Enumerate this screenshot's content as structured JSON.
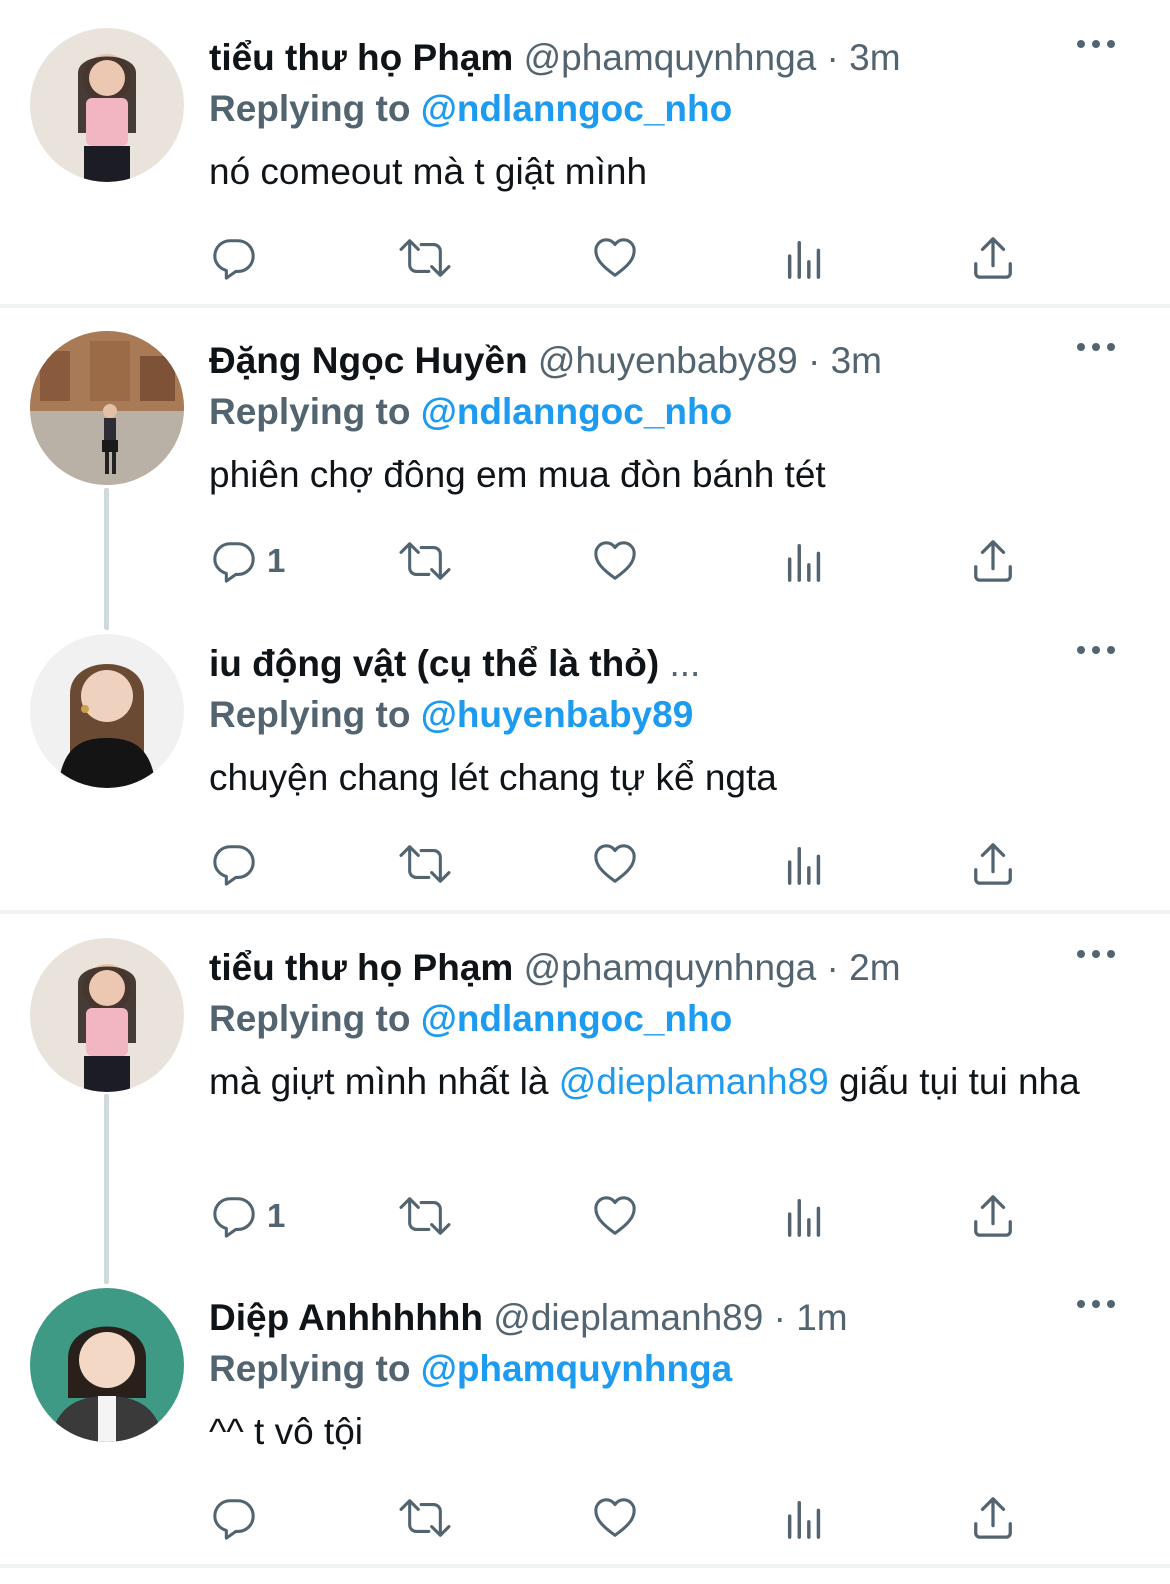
{
  "colors": {
    "link": "#1d9bf0",
    "secondary": "#536471",
    "text": "#0f1419",
    "divider": "#eff3f4"
  },
  "icons": {
    "reply": "reply-icon",
    "retweet": "retweet-icon",
    "like": "heart-icon",
    "views": "analytics-icon",
    "share": "share-icon",
    "more": "more-icon"
  },
  "tweets": [
    {
      "name": "tiểu thư họ Phạm",
      "handle": "@phamquynhnga",
      "dot": "·",
      "time": "3m",
      "reply_prefix": "Replying to",
      "reply_to": "@ndlanngoc_nho",
      "text": "nó comeout mà t giật mình",
      "reply_count": ""
    },
    {
      "name": "Đặng Ngọc Huyền",
      "handle": "@huyenbaby89",
      "dot": "·",
      "time": "3m",
      "reply_prefix": "Replying to",
      "reply_to": "@ndlanngoc_nho",
      "text": "phiên chợ đông em mua đòn bánh tét",
      "reply_count": "1"
    },
    {
      "name": "iu động vật (cụ thể là thỏ)",
      "ellipsis": "...",
      "reply_prefix": "Replying to",
      "reply_to": "@huyenbaby89",
      "text": "chuyện chang lét chang tự kể ngta",
      "reply_count": ""
    },
    {
      "name": "tiểu thư họ Phạm",
      "handle": "@phamquynhnga",
      "dot": "·",
      "time": "2m",
      "reply_prefix": "Replying to",
      "reply_to": "@ndlanngoc_nho",
      "text_before": "mà giựt mình nhất là ",
      "text_mention": "@dieplamanh89",
      "text_after": " giấu tụi tui nha",
      "reply_count": "1"
    },
    {
      "name": "Diệp Anhhhhhh",
      "handle": "@dieplamanh89",
      "dot": "·",
      "time": "1m",
      "reply_prefix": "Replying to",
      "reply_to": "@phamquynhnga",
      "text": "^^ t vô tội",
      "reply_count": ""
    }
  ]
}
